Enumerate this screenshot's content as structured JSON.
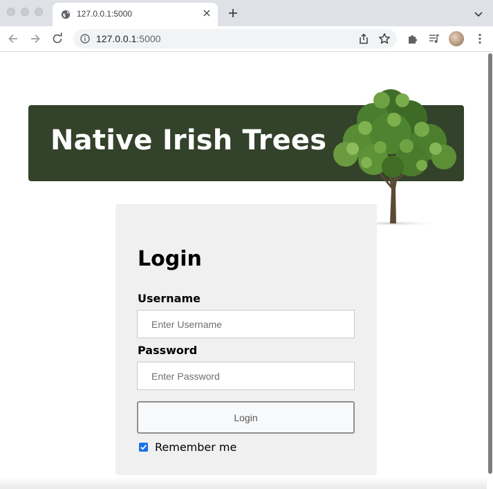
{
  "browser": {
    "tab_title": "127.0.0.1:5000",
    "url_host": "127.0.0.1",
    "url_port": ":5000"
  },
  "banner": {
    "title": "Native Irish Trees",
    "background_color": "#33422b"
  },
  "login": {
    "heading": "Login",
    "username_label": "Username",
    "username_placeholder": "Enter Username",
    "username_value": "",
    "password_label": "Password",
    "password_placeholder": "Enter Password",
    "password_value": "",
    "submit_label": "Login",
    "remember_label": "Remember me",
    "remember_checked": true
  },
  "icons": [
    "globe-icon",
    "close-icon",
    "plus-icon",
    "chevron-down-icon",
    "back-arrow-icon",
    "forward-arrow-icon",
    "reload-icon",
    "info-icon",
    "share-icon",
    "star-icon",
    "puzzle-icon",
    "media-queue-icon",
    "more-vert-icon",
    "check-icon"
  ]
}
